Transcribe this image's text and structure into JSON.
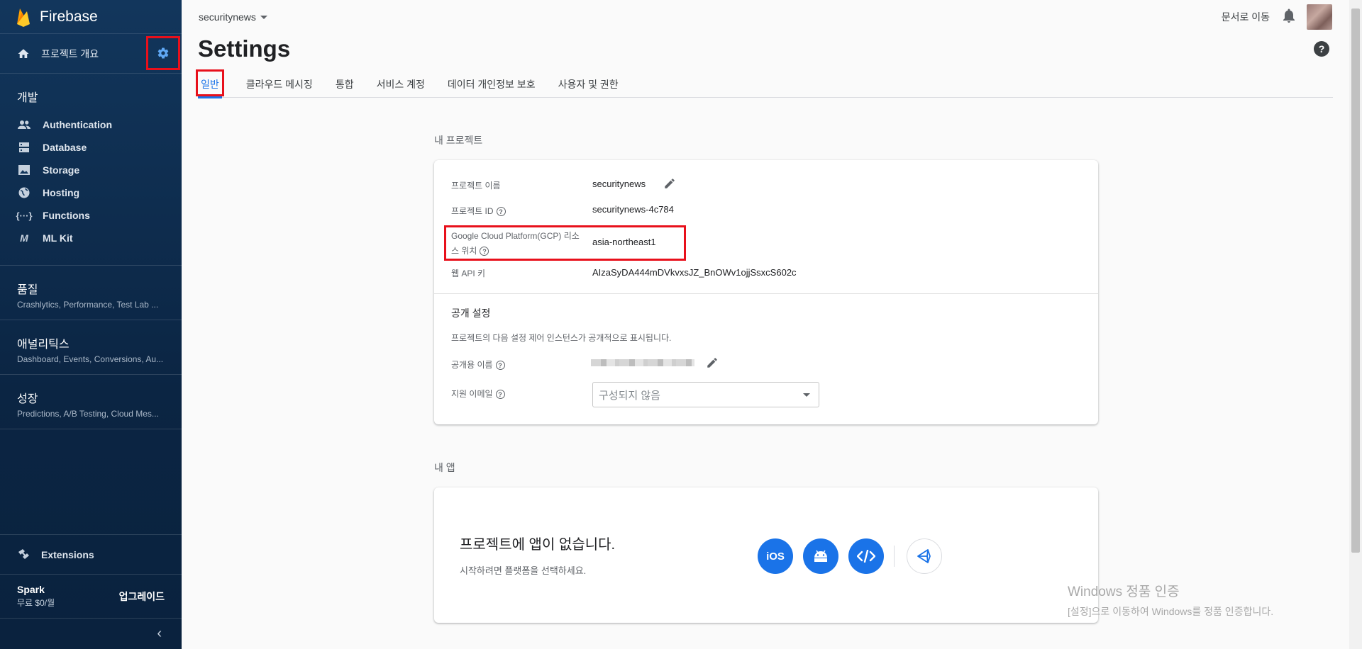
{
  "sidebar": {
    "brand": "Firebase",
    "overview_label": "프로젝트 개요",
    "develop_title": "개발",
    "develop_items": [
      {
        "label": "Authentication",
        "icon": "people-icon"
      },
      {
        "label": "Database",
        "icon": "database-icon"
      },
      {
        "label": "Storage",
        "icon": "image-icon"
      },
      {
        "label": "Hosting",
        "icon": "globe-icon"
      },
      {
        "label": "Functions",
        "icon": "functions-icon"
      },
      {
        "label": "ML Kit",
        "icon": "mlkit-icon"
      }
    ],
    "groups": [
      {
        "title": "품질",
        "subtitle": "Crashlytics, Performance, Test Lab ..."
      },
      {
        "title": "애널리틱스",
        "subtitle": "Dashboard, Events, Conversions, Au..."
      },
      {
        "title": "성장",
        "subtitle": "Predictions, A/B Testing, Cloud Mes..."
      }
    ],
    "extensions_label": "Extensions",
    "plan_name": "Spark",
    "plan_price": "무료 $0/월",
    "upgrade_label": "업그레이드"
  },
  "topbar": {
    "project": "securitynews",
    "docs_link": "문서로 이동"
  },
  "page": {
    "title": "Settings",
    "tabs": [
      "일반",
      "클라우드 메시징",
      "통합",
      "서비스 계정",
      "데이터 개인정보 보호",
      "사용자 및 권한"
    ],
    "active_tab": "일반"
  },
  "my_project": {
    "section_label": "내 프로젝트",
    "rows": {
      "name_label": "프로젝트 이름",
      "name_value": "securitynews",
      "id_label": "프로젝트 ID",
      "id_value": "securitynews-4c784",
      "gcp_label_line1": "Google Cloud Platform(GCP) 리소",
      "gcp_label_line2": "스 위치",
      "gcp_value": "asia-northeast1",
      "api_label": "웹 API 키",
      "api_value": "AIzaSyDA444mDVkvxsJZ_BnOWv1ojjSsxcS602c"
    },
    "public_settings": {
      "title": "공개 설정",
      "description": "프로젝트의 다음 설정 제어 인스턴스가 공개적으로 표시됩니다.",
      "public_name_label": "공개용 이름",
      "support_email_label": "지원 이메일",
      "support_email_value": "구성되지 않음"
    }
  },
  "my_apps": {
    "section_label": "내 앱",
    "empty_title": "프로젝트에 앱이 없습니다.",
    "empty_hint": "시작하려면 플랫폼을 선택하세요.",
    "platforms": [
      "iOS",
      "android-icon",
      "web-code-icon",
      "unity-icon"
    ],
    "ios_label": "iOS"
  },
  "watermark": {
    "line1": "Windows 정품 인증",
    "line2": "[설정]으로 이동하여 Windows를 정품 인증합니다."
  },
  "colors": {
    "sidebar_bg": "#0b2543",
    "accent": "#1a73e8",
    "highlight_box": "#e8101b"
  }
}
